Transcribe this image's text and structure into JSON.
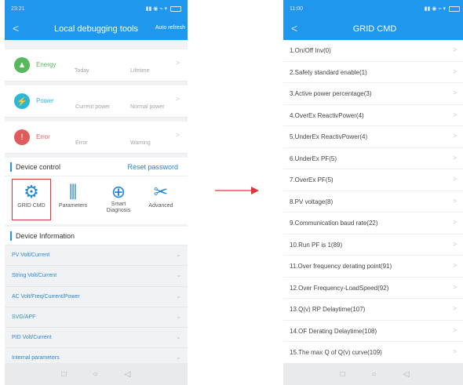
{
  "left": {
    "status": {
      "time": "23:21",
      "right": "▮▮ ◉ ⌁ ▾"
    },
    "title": "Local debugging tools",
    "action": "Auto refresh",
    "stats": [
      {
        "name": "Energy",
        "color": "#58b85c",
        "icon": "chart-icon",
        "glyph": "▲",
        "subs": [
          "Today",
          "Lifetime"
        ]
      },
      {
        "name": "Power",
        "color": "#2cb7d8",
        "icon": "bolt-icon",
        "glyph": "⚡",
        "subs": [
          "Current power",
          "Normal power"
        ]
      },
      {
        "name": "Error",
        "color": "#e05b5b",
        "icon": "alert-icon",
        "glyph": "!",
        "subs": [
          "Error",
          "Warning"
        ]
      }
    ],
    "device_control": {
      "label": "Device control",
      "reset": "Reset password"
    },
    "tools": [
      {
        "label": "GRID CMD",
        "icon": "gears-icon",
        "glyph": "⚙"
      },
      {
        "label": "Parameters",
        "icon": "sliders-icon",
        "glyph": "⫼"
      },
      {
        "label": "Smart Diagnosis",
        "icon": "target-icon",
        "glyph": "⊕"
      },
      {
        "label": "Advanced",
        "icon": "tools-icon",
        "glyph": "✂"
      }
    ],
    "device_info": {
      "label": "Device Information"
    },
    "info_items": [
      "PV Volt/Current",
      "String Volt/Current",
      "AC Volt/Freq/Current/Power",
      "SVG/APF",
      "PID Volt/Current",
      "Internal parameters"
    ]
  },
  "right": {
    "status": {
      "time": "11:00",
      "right": "▮▮ ◉ ⌁ ▾"
    },
    "title": "GRID CMD",
    "commands": [
      "1.On/Off Inv(0)",
      "2.Safety standard enable(1)",
      "3.Active power percentage(3)",
      "4.OverEx ReactivPower(4)",
      "5.UnderEx ReactivPower(4)",
      "6.UnderEx PF(5)",
      "7.OverEx PF(5)",
      "8.PV voltage(8)",
      "9.Communication baud rate(22)",
      "10.Run PF is 1(89)",
      "11.Over frequency derating point(91)",
      "12.Over Frequency-LoadSpeed(92)",
      "13.Q(v) RP Delaytime(107)",
      "14.OF Derating Delaytime(108)",
      "15.The max Q of Q(v) curve(109)"
    ]
  },
  "colors": {
    "accent": "#1e97ec",
    "highlight": "#e0353b"
  }
}
